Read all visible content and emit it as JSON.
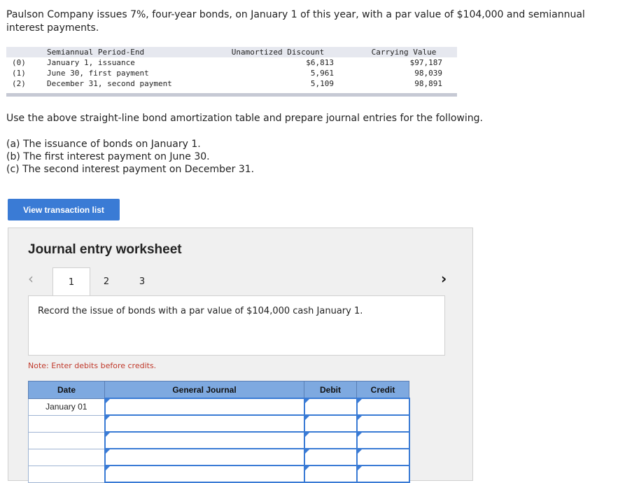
{
  "problem": {
    "text": "Paulson Company issues 7%, four-year bonds, on January 1 of this year, with a par value of $104,000 and semiannual interest payments."
  },
  "amortization_table": {
    "headers": {
      "period": "Semiannual Period-End",
      "discount": "Unamortized Discount",
      "carrying": "Carrying Value"
    },
    "rows": [
      {
        "idx": "(0)",
        "period": "January 1, issuance",
        "discount": "$6,813",
        "carrying": "$97,187"
      },
      {
        "idx": "(1)",
        "period": "June 30, first payment",
        "discount": "5,961",
        "carrying": "98,039"
      },
      {
        "idx": "(2)",
        "period": "December 31, second payment",
        "discount": "5,109",
        "carrying": "98,891"
      }
    ]
  },
  "instruction": "Use the above straight-line bond amortization table and prepare journal entries for the following.",
  "requirements": [
    "(a) The issuance of bonds on January 1.",
    "(b) The first interest payment on June 30.",
    "(c) The second interest payment on December 31."
  ],
  "view_button": "View transaction list",
  "worksheet": {
    "title": "Journal entry worksheet",
    "tabs": [
      "1",
      "2",
      "3"
    ],
    "active_tab": 0,
    "prev_icon": "chevron-left-icon",
    "next_icon": "chevron-right-icon",
    "record_text": "Record the issue of bonds with a par value of $104,000 cash January 1.",
    "note": "Note: Enter debits before credits.",
    "journal": {
      "headers": {
        "date": "Date",
        "general": "General Journal",
        "debit": "Debit",
        "credit": "Credit"
      },
      "rows": [
        {
          "date": "January 01"
        },
        {
          "date": ""
        },
        {
          "date": ""
        },
        {
          "date": ""
        },
        {
          "date": ""
        }
      ]
    }
  }
}
